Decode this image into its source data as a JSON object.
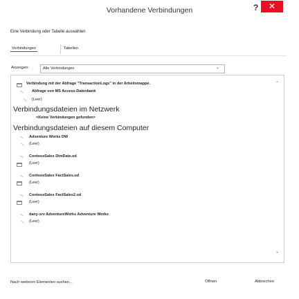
{
  "window": {
    "title": "Vorhandene Verbindungen",
    "help": "?",
    "close": "✕"
  },
  "prompt": "Eine Verbindung oder Tabelle auswählen",
  "tabs": [
    "Verbindungen",
    "Tabellen"
  ],
  "filter": {
    "label": "Anzeigen:",
    "value": "Alle Verbindungen"
  },
  "list": {
    "top_item": "Verbindung mit der Abfrage \"TransactionLogs\" in der Arbeitsmappe.",
    "query_item": "Abfrage von MS Access-Datenbank",
    "empty": "(Leer)",
    "section1": "Verbindungsdateien im Netzwerk",
    "no_conn": "<Keine Verbindungen gefunden>",
    "section2": "Verbindungsdateien auf diesem Computer",
    "files": [
      "Adventure Works DW",
      "ContosoSales DimDate.od",
      "ContosoSales FactSales.od",
      "ContosoSales FactSales2.od",
      "dany-srv AdventureWorks Adventure Works"
    ]
  },
  "footer": {
    "find_more": "Nach weiteren Elementen suchen...",
    "open": "Öffnen",
    "cancel": "Abbrechen"
  }
}
